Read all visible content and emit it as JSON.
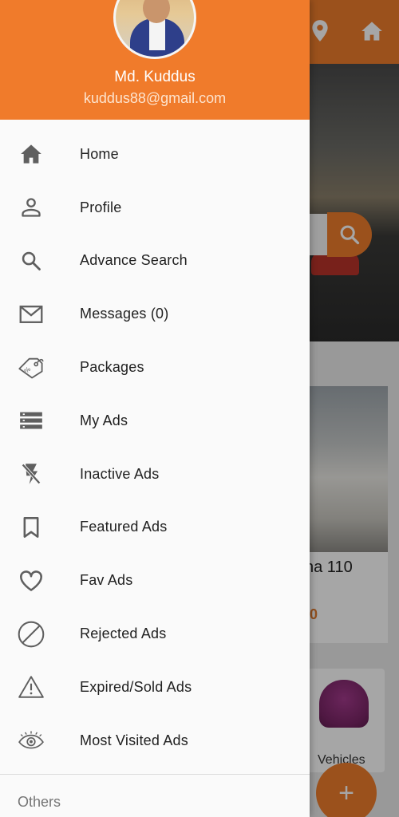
{
  "colors": {
    "accent": "#EE7D2C",
    "drawer_bg": "#FAFAFA",
    "icon_gray": "#5F5F5F"
  },
  "user": {
    "name": "Md. Kuddus",
    "email": "kuddus88@gmail.com"
  },
  "menu": [
    {
      "label": "Home",
      "icon": "home-icon"
    },
    {
      "label": "Profile",
      "icon": "person-icon"
    },
    {
      "label": "Advance Search",
      "icon": "search-icon"
    },
    {
      "label": "Messages (0)",
      "icon": "mail-icon"
    },
    {
      "label": "Packages",
      "icon": "price-tag-icon"
    },
    {
      "label": "My Ads",
      "icon": "list-icon"
    },
    {
      "label": "Inactive Ads",
      "icon": "flash-off-icon"
    },
    {
      "label": "Featured Ads",
      "icon": "bookmark-icon"
    },
    {
      "label": "Fav Ads",
      "icon": "heart-icon"
    },
    {
      "label": "Rejected Ads",
      "icon": "block-icon"
    },
    {
      "label": "Expired/Sold  Ads",
      "icon": "warning-icon"
    },
    {
      "label": "Most Visited Ads",
      "icon": "eye-icon"
    }
  ],
  "others_label": "Others",
  "background": {
    "card_title": "na 110",
    "card_price": "00",
    "category_label": "Vehicles",
    "fab_icon": "add-icon"
  }
}
